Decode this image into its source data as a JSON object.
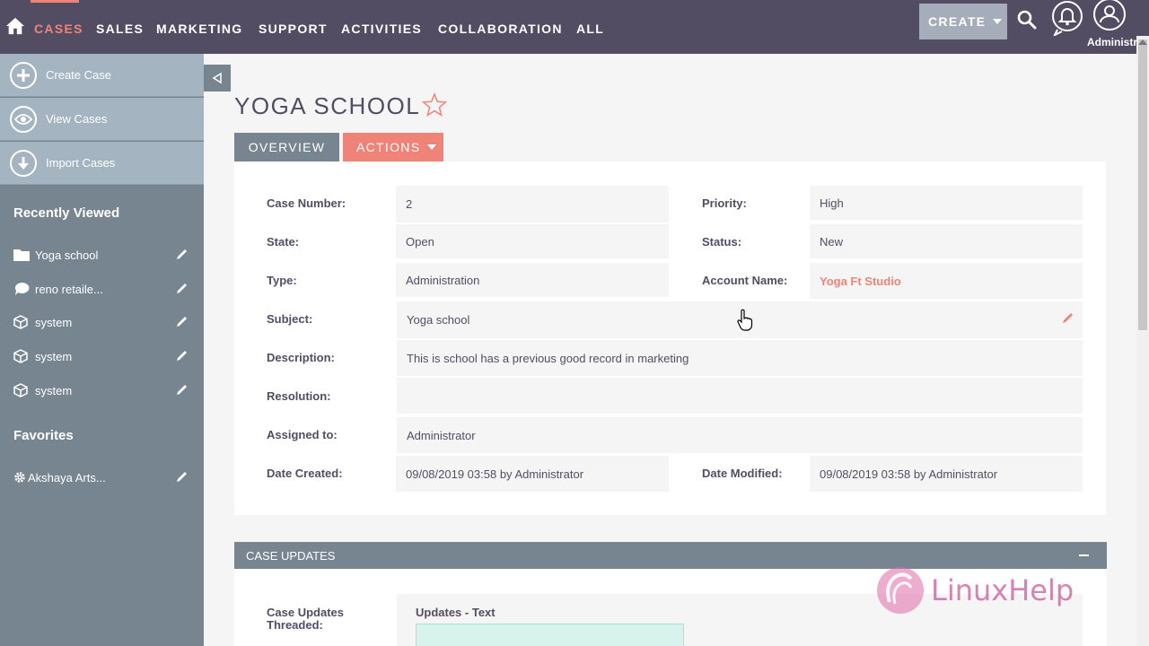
{
  "nav": {
    "items": [
      "CASES",
      "SALES",
      "MARKETING",
      "SUPPORT",
      "ACTIVITIES",
      "COLLABORATION",
      "ALL"
    ],
    "create_label": "CREATE",
    "user_name": "Administrator"
  },
  "sidebar": {
    "actions": [
      "Create Case",
      "View Cases",
      "Import Cases"
    ],
    "recently_viewed_heading": "Recently Viewed",
    "recently_viewed": [
      "Yoga school",
      "reno retaile...",
      "system",
      "system",
      "system"
    ],
    "favorites_heading": "Favorites",
    "favorites": [
      "Akshaya Arts..."
    ]
  },
  "record": {
    "title": "YOGA SCHOOL",
    "tabs": {
      "overview": "OVERVIEW",
      "actions": "ACTIONS"
    },
    "fields": {
      "case_number_label": "Case Number:",
      "case_number": "2",
      "priority_label": "Priority:",
      "priority": "High",
      "state_label": "State:",
      "state": "Open",
      "status_label": "Status:",
      "status": "New",
      "type_label": "Type:",
      "type": "Administration",
      "account_name_label": "Account Name:",
      "account_name": "Yoga Ft Studio",
      "subject_label": "Subject:",
      "subject": "Yoga school",
      "description_label": "Description:",
      "description": "This is school has a previous good record in marketing",
      "resolution_label": "Resolution:",
      "resolution": "",
      "assigned_label": "Assigned to:",
      "assigned": "Administrator",
      "date_created_label": "Date Created:",
      "date_created": "09/08/2019 03:58 by Administrator",
      "date_modified_label": "Date Modified:",
      "date_modified": "09/08/2019 03:58 by Administrator"
    }
  },
  "updates": {
    "header": "CASE UPDATES",
    "threaded_label": "Case Updates Threaded:",
    "text_label": "Updates - Text"
  },
  "watermark": {
    "text": "LinuxHelp"
  },
  "colors": {
    "nav_bg": "#534d64",
    "accent": "#f08377",
    "sidebar_bg": "#778591",
    "sidebar_action_bg": "#a5b4c1"
  }
}
